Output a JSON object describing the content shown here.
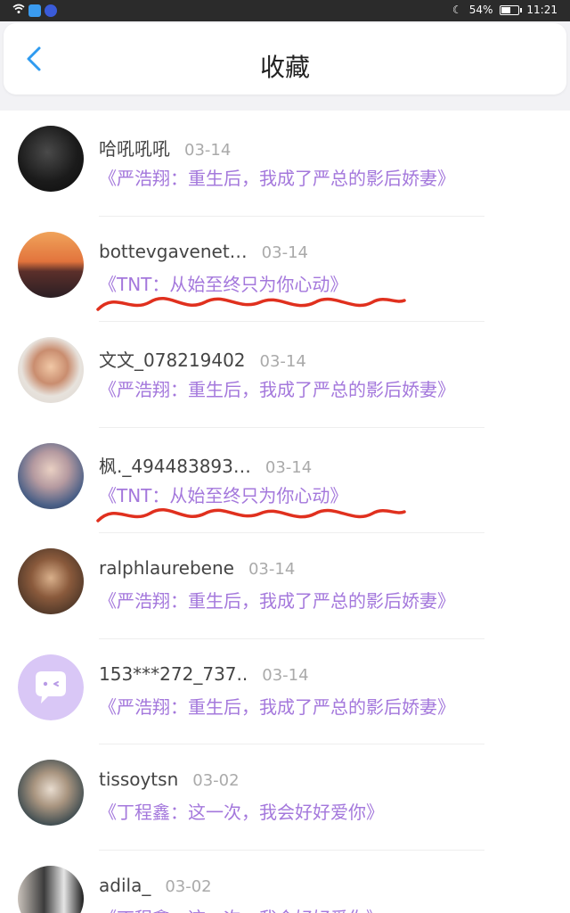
{
  "status_bar": {
    "battery": "54%",
    "battery_level": 0.54,
    "time": "11:21"
  },
  "header": {
    "title": "收藏"
  },
  "favorites": [
    {
      "name": "哈吼吼吼",
      "date": "03-14",
      "book": "《严浩翔：重生后，我成了严总的影后娇妻》",
      "underlined": false
    },
    {
      "name": "bottevgavenet…",
      "date": "03-14",
      "book": "《TNT：从始至终只为你心动》",
      "underlined": true
    },
    {
      "name": "文文_078219402",
      "date": "03-14",
      "book": "《严浩翔：重生后，我成了严总的影后娇妻》",
      "underlined": false
    },
    {
      "name": "枫._494483893…",
      "date": "03-14",
      "book": "《TNT：从始至终只为你心动》",
      "underlined": true
    },
    {
      "name": "ralphlaurebene",
      "date": "03-14",
      "book": "《严浩翔：重生后，我成了严总的影后娇妻》",
      "underlined": false
    },
    {
      "name": "153***272_737..",
      "date": "03-14",
      "book": "《严浩翔：重生后，我成了严总的影后娇妻》",
      "underlined": false
    },
    {
      "name": "tissoytsn",
      "date": "03-02",
      "book": "《丁程鑫：这一次，我会好好爱你》",
      "underlined": false
    },
    {
      "name": "adila_",
      "date": "03-02",
      "book": "《丁程鑫：这一次，我会好好爱你》",
      "underlined": false
    }
  ],
  "colors": {
    "accent": "#a478dc",
    "back_arrow": "#2f9bf0",
    "annotation": "#e0301e"
  }
}
